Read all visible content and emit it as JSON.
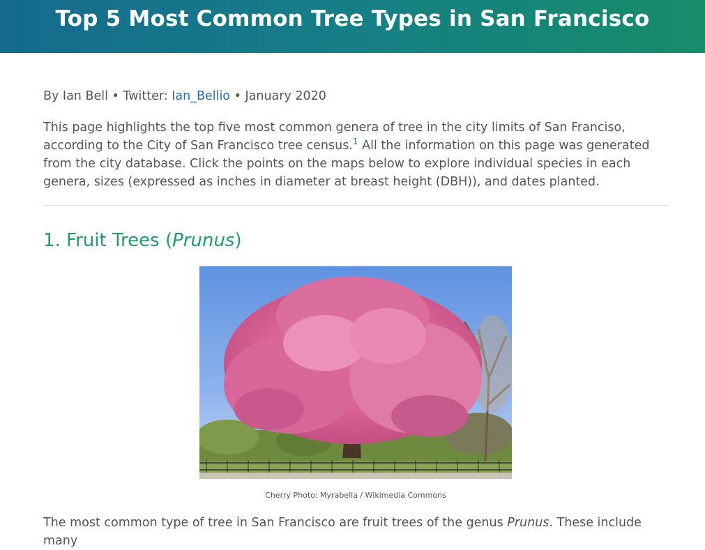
{
  "header": {
    "title": "Top 5 Most Common Tree Types in San Francisco",
    "gradient_start": "#166a8d",
    "gradient_end": "#178c69"
  },
  "byline": {
    "prefix": "By Ian Bell • Twitter: ",
    "twitter_handle": "Ian_Bellio",
    "suffix": " • January 2020"
  },
  "intro": {
    "part1": "This page highlights the top five most common genera of tree in the city limits of San Franciso, according to the City of San Francisco tree census.",
    "footnote": "1",
    "part2": " All the information on this page was generated from the city database. Click the points on the maps below to explore individual species in each genera, sizes (expressed as inches in diameter at breast height (DBH)), and dates planted."
  },
  "section1": {
    "title_prefix": "1. Fruit Trees (",
    "title_genus": "Prunus",
    "title_suffix": ")",
    "image_subject": "pink cherry blossom tree in park",
    "caption": "Cherry Photo: Myrabella / Wikimedia Commons",
    "body_prefix": "The most common type of tree in San Francisco are fruit trees of the genus ",
    "body_genus": "Prunus",
    "body_suffix": ". These include many"
  },
  "colors": {
    "accent_green": "#1e9c6b",
    "link_blue": "#2b6db0",
    "text_gray": "#555555"
  }
}
